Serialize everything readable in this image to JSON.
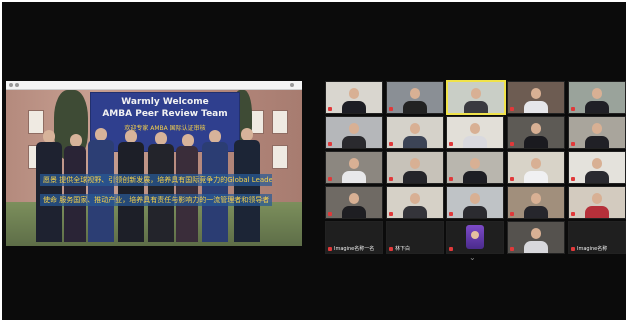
{
  "shared_screen": {
    "banner_line1": "Warmly Welcome",
    "banner_line2": "AMBA Peer Review Team",
    "banner_line3": "欢迎专家 AMBA 国际认证审核",
    "caption_label_1": "愿景",
    "caption_text_1": "提供全球视野、引领创新发展，培养具有国际竞争力的Global Leaders",
    "caption_label_2": "使命",
    "caption_text_2": "服务国家、推动产业，培养具有责任与影响力的一流管理者和领导者"
  },
  "gallery": {
    "tiles": [
      {
        "label": "",
        "active": false
      },
      {
        "label": "",
        "active": false
      },
      {
        "label": "",
        "active": true
      },
      {
        "label": "",
        "active": false
      },
      {
        "label": "",
        "active": false
      },
      {
        "label": "",
        "active": false
      },
      {
        "label": "",
        "active": false
      },
      {
        "label": "",
        "active": false
      },
      {
        "label": "",
        "active": false
      },
      {
        "label": "",
        "active": false
      },
      {
        "label": "",
        "active": false
      },
      {
        "label": "",
        "active": false
      },
      {
        "label": "",
        "active": false
      },
      {
        "label": "",
        "active": false
      },
      {
        "label": "",
        "active": false
      },
      {
        "label": "",
        "active": false
      },
      {
        "label": "",
        "active": false
      },
      {
        "label": "",
        "active": false
      },
      {
        "label": "",
        "active": false
      },
      {
        "label": "",
        "active": false
      },
      {
        "label": "",
        "active": false
      },
      {
        "label": "",
        "active": false
      },
      {
        "label": "",
        "active": false
      },
      {
        "label": "",
        "active": false
      },
      {
        "label": "",
        "active": false
      },
      {
        "label": "Imagine名称一名",
        "active": false
      },
      {
        "label": "林下白",
        "active": false
      },
      {
        "label": "",
        "active": false
      },
      {
        "label": "",
        "active": false
      },
      {
        "label": "Imagine名称",
        "active": false
      }
    ],
    "pager_icon": "chevron-down-icon",
    "pager_glyph": "⌄"
  },
  "colors": {
    "background": "#0b0b0b",
    "active_speaker_border": "#f0e34a",
    "muted_mic": "#e0393a"
  }
}
